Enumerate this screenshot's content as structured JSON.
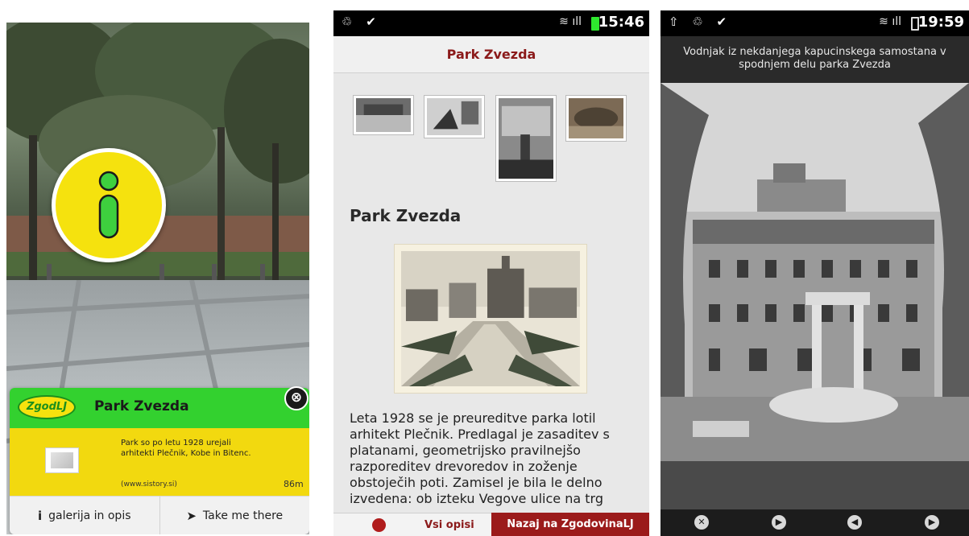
{
  "screen1": {
    "card": {
      "logo_text": "ZgodLJ",
      "title": "Park Zvezda",
      "description": "Park so po letu 1928 urejali arhitekti Plečnik, Kobe in Bitenc.",
      "source": "(www.sistory.si)",
      "distance": "86m",
      "close_icon": "⊗",
      "action_gallery_label": "galerija in opis",
      "action_gallery_icon": "i",
      "action_navigate_label": "Take me there",
      "action_navigate_icon": "➤"
    },
    "colors": {
      "green": "#33d12f",
      "yellow": "#f2d90f"
    }
  },
  "screen2": {
    "status_icons_left": "♲ ✔",
    "status_icons_right": "≋ ıll",
    "time": "15:46",
    "title": "Park Zvezda",
    "section_title": "Park Zvezda",
    "body": "Leta 1928 se je preureditve parka lotil arhitekt Plečnik. Predlagal je zasaditev s platanami, geometrijsko pravilnejšo razporeditev drevoredov in zoženje obstoječih poti. Zamisel je bila le delno izvedena: ob izteku Vegove ulice na trg",
    "bottom_left_label": "Vsi opisi",
    "bottom_right_label": "Nazaj na ZgodovinaLJ",
    "colors": {
      "accent": "#8b1a1a",
      "bar": "#9b1b1b"
    }
  },
  "screen3": {
    "status_icons_left": "⇧ ♲ ✔",
    "status_icons_right": "≋ ıll",
    "time": "19:59",
    "caption": "Vodnjak iz nekdanjega kapucinskega samostana v spodnjem delu parka Zvezda",
    "controls": [
      "✕",
      "▶",
      "◀",
      "▶"
    ]
  }
}
